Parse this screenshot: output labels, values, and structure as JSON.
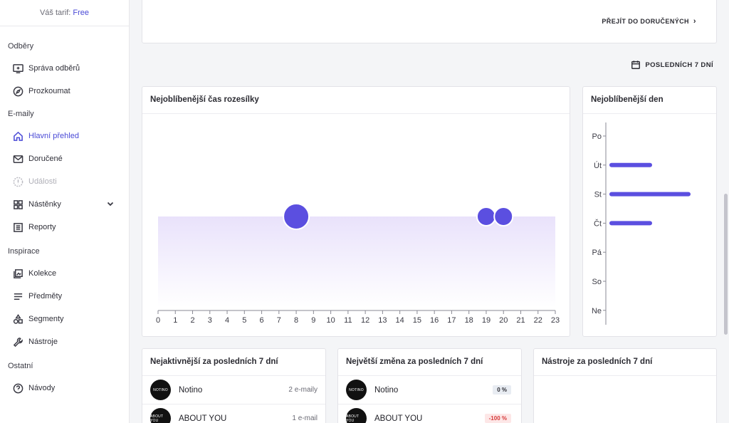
{
  "sidebar": {
    "tariff_label": "Váš tarif: ",
    "tariff_plan": "Free",
    "sections": {
      "subscriptions": "Odběry",
      "emails": "E-maily",
      "inspiration": "Inspirace",
      "other": "Ostatní"
    },
    "items": {
      "manage": "Správa odběrů",
      "explore": "Prozkoumat",
      "overview": "Hlavní přehled",
      "inbox": "Doručené",
      "events": "Události",
      "boards": "Nástěnky",
      "reports": "Reporty",
      "collections": "Kolekce",
      "subjects": "Předměty",
      "segments": "Segmenty",
      "tools": "Nástroje",
      "guides": "Návody"
    }
  },
  "top": {
    "inbox_link": "PŘEJÍT DO DORUČENÝCH"
  },
  "period": "POSLEDNÍCH 7 DNÍ",
  "hour_card": {
    "title": "Nejoblíbenější čas rozesílky"
  },
  "day_card": {
    "title": "Nejoblíbenější den"
  },
  "bottom": {
    "active_title": "Nejaktivnější za posledních 7 dní",
    "change_title": "Největší změna za posledních 7 dní",
    "tools_title": "Nástroje za posledních 7 dní",
    "active_rows": [
      {
        "logo": "NOTINO",
        "name": "Notino",
        "count": "2 e-maily"
      },
      {
        "logo": "ABOUT YOU",
        "name": "ABOUT YOU",
        "count": "1 e-mail"
      }
    ],
    "change_rows": [
      {
        "logo": "NOTINO",
        "name": "Notino",
        "badge": "0 %"
      },
      {
        "logo": "ABOUT YOU",
        "name": "ABOUT YOU",
        "badge": "-100 %"
      }
    ]
  },
  "colors": {
    "accent": "#5b4fe0",
    "band": "#ece6fb"
  },
  "chart_data": [
    {
      "type": "scatter",
      "title": "Nejoblíbenější čas rozesílky",
      "x_ticks": [
        0,
        1,
        2,
        3,
        4,
        5,
        6,
        7,
        8,
        9,
        10,
        11,
        12,
        13,
        14,
        15,
        16,
        17,
        18,
        19,
        20,
        21,
        22,
        23
      ],
      "xlim": [
        0,
        23
      ],
      "points": [
        {
          "x": 8,
          "size": 2
        },
        {
          "x": 19,
          "size": 1
        },
        {
          "x": 20,
          "size": 1
        }
      ]
    },
    {
      "type": "bar",
      "orientation": "horizontal",
      "title": "Nejoblíbenější den",
      "categories": [
        "Po",
        "Út",
        "St",
        "Čt",
        "Pá",
        "So",
        "Ne"
      ],
      "values": [
        0,
        1,
        2,
        1,
        0,
        0,
        0
      ],
      "xlim": [
        0,
        2
      ]
    }
  ]
}
